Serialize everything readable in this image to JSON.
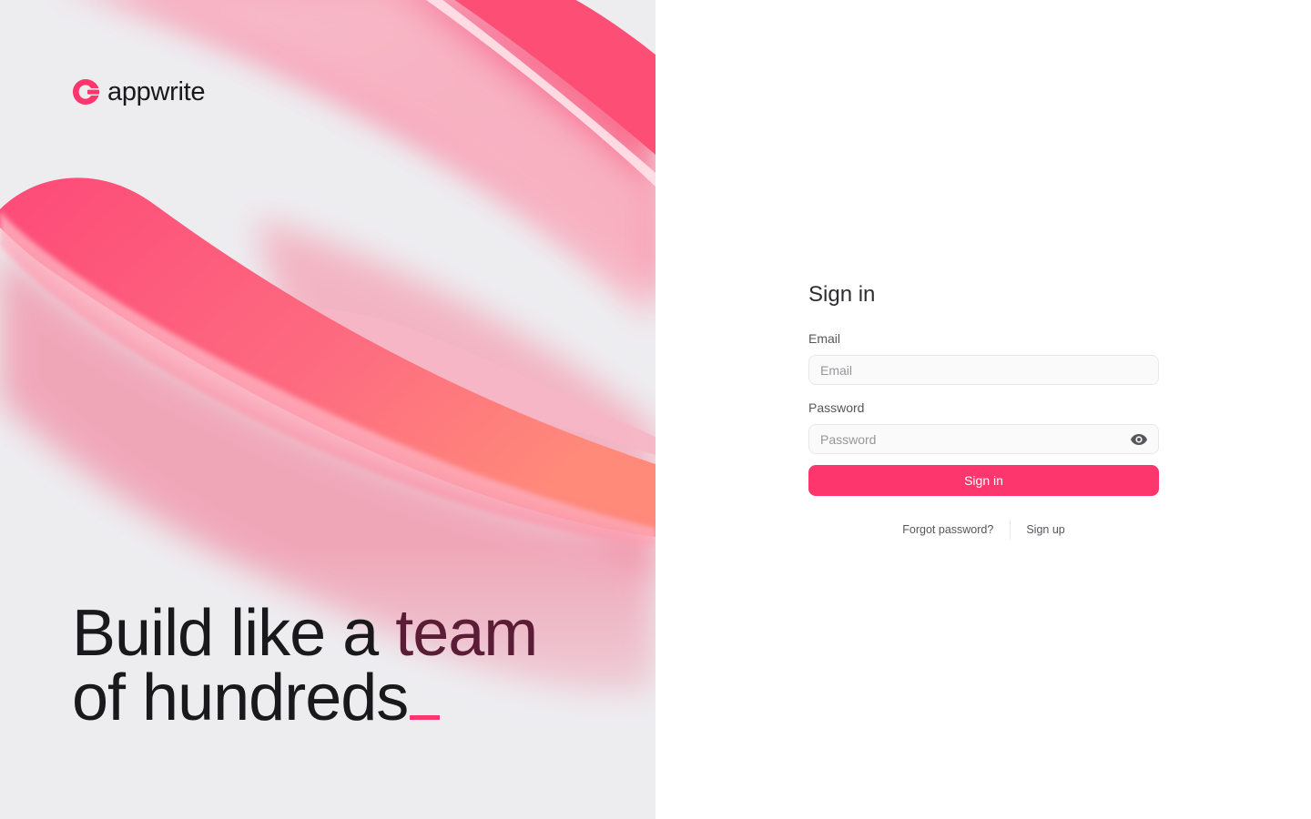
{
  "brand": {
    "name": "appwrite",
    "accent_color": "#fd366e",
    "logo_icon": "appwrite-logo-icon"
  },
  "hero": {
    "tagline_line1_prefix": "Build like a ",
    "tagline_line1_highlight": "team",
    "tagline_line2": "of hundreds"
  },
  "signin": {
    "title": "Sign in",
    "email_label": "Email",
    "email_placeholder": "Email",
    "email_value": "",
    "password_label": "Password",
    "password_placeholder": "Password",
    "password_value": "",
    "password_toggle_icon": "eye-icon",
    "submit_label": "Sign in",
    "forgot_password_link": "Forgot password?",
    "sign_up_link": "Sign up"
  }
}
